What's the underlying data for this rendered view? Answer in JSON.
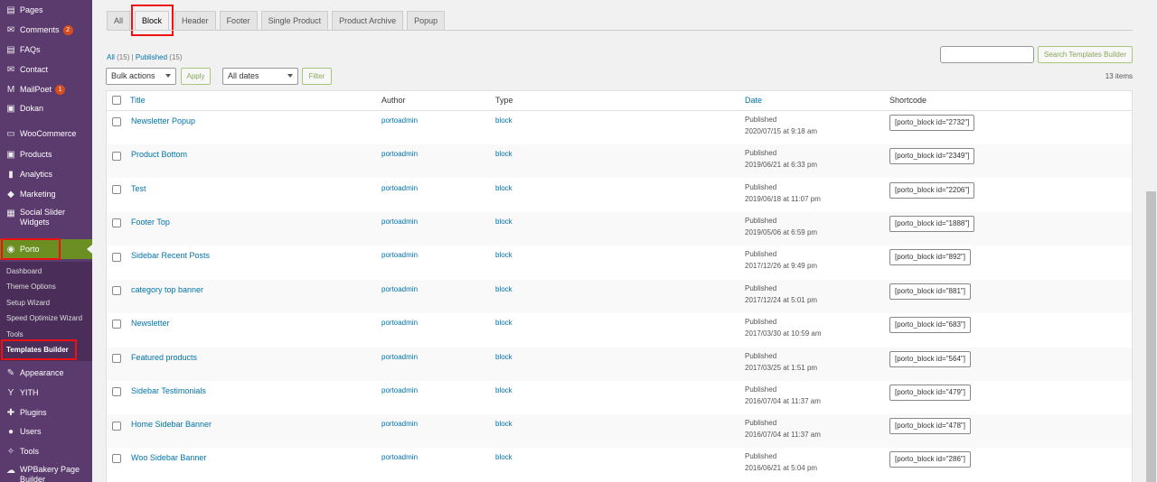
{
  "sidebar": {
    "items": [
      {
        "label": "Pages",
        "icon": "pages-icon",
        "glyph": "▤"
      },
      {
        "label": "Comments",
        "icon": "comments-icon",
        "glyph": "✉",
        "badge": "2"
      },
      {
        "label": "FAQs",
        "icon": "faqs-icon",
        "glyph": "▤"
      },
      {
        "label": "Contact",
        "icon": "contact-icon",
        "glyph": "✉"
      },
      {
        "label": "MailPoet",
        "icon": "mailpoet-icon",
        "glyph": "M",
        "badge": "1"
      },
      {
        "label": "Dokan",
        "icon": "dokan-icon",
        "glyph": "▣"
      },
      {
        "label": "WooCommerce",
        "icon": "woocommerce-icon",
        "glyph": "▭"
      },
      {
        "label": "Products",
        "icon": "products-icon",
        "glyph": "▣"
      },
      {
        "label": "Analytics",
        "icon": "analytics-icon",
        "glyph": "▮"
      },
      {
        "label": "Marketing",
        "icon": "marketing-icon",
        "glyph": "◆"
      },
      {
        "label": "Social Slider Widgets",
        "icon": "social-slider-icon",
        "glyph": "▦"
      },
      {
        "label": "Porto",
        "icon": "porto-icon",
        "glyph": "◉"
      },
      {
        "label": "Appearance",
        "icon": "appearance-icon",
        "glyph": "✎"
      },
      {
        "label": "YITH",
        "icon": "yith-icon",
        "glyph": "Y"
      },
      {
        "label": "Plugins",
        "icon": "plugins-icon",
        "glyph": "✚"
      },
      {
        "label": "Users",
        "icon": "users-icon",
        "glyph": "●"
      },
      {
        "label": "Tools",
        "icon": "tools-icon",
        "glyph": "✧"
      },
      {
        "label": "WPBakery Page Builder",
        "icon": "wpbakery-icon",
        "glyph": "☁"
      }
    ],
    "submenu": [
      "Dashboard",
      "Theme Options",
      "Setup Wizard",
      "Speed Optimize Wizard",
      "Tools",
      "Templates Builder"
    ]
  },
  "tabs": [
    "All",
    "Block",
    "Header",
    "Footer",
    "Single Product",
    "Product Archive",
    "Popup"
  ],
  "filters": {
    "all_link": "All",
    "all_count": "(15)",
    "separator": "|",
    "published_link": "Published",
    "published_count": "(15)",
    "bulk_actions": "Bulk actions",
    "apply": "Apply",
    "all_dates": "All dates",
    "filter": "Filter",
    "search_button": "Search Templates Builder",
    "items_count": "13 items"
  },
  "columns": {
    "title": "Title",
    "author": "Author",
    "type": "Type",
    "date": "Date",
    "shortcode": "Shortcode"
  },
  "rows": [
    {
      "title": "Newsletter Popup",
      "author": "portoadmin",
      "type": "block",
      "status": "Published",
      "date": "2020/07/15 at 9:18 am",
      "shortcode": "[porto_block id=\"2732\"]"
    },
    {
      "title": "Product Bottom",
      "author": "portoadmin",
      "type": "block",
      "status": "Published",
      "date": "2019/06/21 at 6:33 pm",
      "shortcode": "[porto_block id=\"2349\"]"
    },
    {
      "title": "Test",
      "author": "portoadmin",
      "type": "block",
      "status": "Published",
      "date": "2019/06/18 at 11:07 pm",
      "shortcode": "[porto_block id=\"2206\"]"
    },
    {
      "title": "Footer Top",
      "author": "portoadmin",
      "type": "block",
      "status": "Published",
      "date": "2019/05/06 at 6:59 pm",
      "shortcode": "[porto_block id=\"1888\"]"
    },
    {
      "title": "Sidebar Recent Posts",
      "author": "portoadmin",
      "type": "block",
      "status": "Published",
      "date": "2017/12/26 at 9:49 pm",
      "shortcode": "[porto_block id=\"892\"]"
    },
    {
      "title": "category top banner",
      "author": "portoadmin",
      "type": "block",
      "status": "Published",
      "date": "2017/12/24 at 5:01 pm",
      "shortcode": "[porto_block id=\"881\"]"
    },
    {
      "title": "Newsletter",
      "author": "portoadmin",
      "type": "block",
      "status": "Published",
      "date": "2017/03/30 at 10:59 am",
      "shortcode": "[porto_block id=\"683\"]"
    },
    {
      "title": "Featured products",
      "author": "portoadmin",
      "type": "block",
      "status": "Published",
      "date": "2017/03/25 at 1:51 pm",
      "shortcode": "[porto_block id=\"564\"]"
    },
    {
      "title": "Sidebar Testimonials",
      "author": "portoadmin",
      "type": "block",
      "status": "Published",
      "date": "2016/07/04 at 11:37 am",
      "shortcode": "[porto_block id=\"479\"]"
    },
    {
      "title": "Home Sidebar Banner",
      "author": "portoadmin",
      "type": "block",
      "status": "Published",
      "date": "2016/07/04 at 11:37 am",
      "shortcode": "[porto_block id=\"478\"]"
    },
    {
      "title": "Woo Sidebar Banner",
      "author": "portoadmin",
      "type": "block",
      "status": "Published",
      "date": "2016/06/21 at 5:04 pm",
      "shortcode": "[porto_block id=\"286\"]"
    }
  ],
  "colors": {
    "sidebar": "#5b3a6e",
    "porto_active": "#6b8f23",
    "link": "#0073aa",
    "highlight_box": "#ee1111"
  }
}
